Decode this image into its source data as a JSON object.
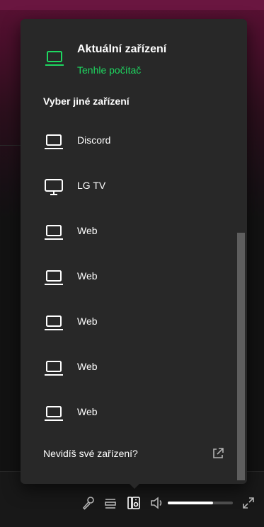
{
  "popup": {
    "current_title": "Aktuální zařízení",
    "current_subtitle": "Tenhle počítač",
    "current_icon": "laptop-icon",
    "section_title": "Vyber jiné zařízení",
    "devices": [
      {
        "label": "Discord",
        "icon": "laptop-icon"
      },
      {
        "label": "LG TV",
        "icon": "tv-icon"
      },
      {
        "label": "Web",
        "icon": "laptop-icon"
      },
      {
        "label": "Web",
        "icon": "laptop-icon"
      },
      {
        "label": "Web",
        "icon": "laptop-icon"
      },
      {
        "label": "Web",
        "icon": "laptop-icon"
      },
      {
        "label": "Web",
        "icon": "laptop-icon"
      }
    ],
    "footer_text": "Nevidíš své zařízení?",
    "footer_icon": "external-link-icon"
  },
  "player_controls": {
    "icons": [
      "microphone-icon",
      "queue-icon",
      "connect-device-icon",
      "volume-icon",
      "fullscreen-icon"
    ],
    "volume_level": 0.7
  },
  "colors": {
    "accent": "#1ed760",
    "popup_bg": "#282828",
    "background": "#121212",
    "header_gradient": "#5a1134"
  }
}
